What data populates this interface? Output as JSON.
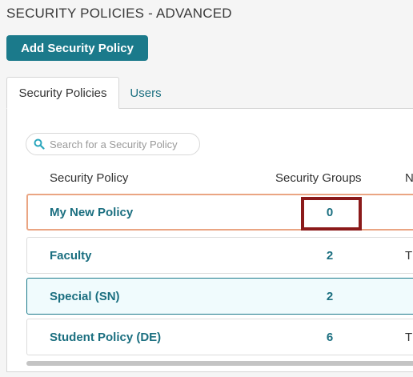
{
  "page": {
    "title": "SECURITY POLICIES - ADVANCED"
  },
  "toolbar": {
    "add_label": "Add Security Policy"
  },
  "tabs": [
    {
      "label": "Security Policies",
      "active": true
    },
    {
      "label": "Users",
      "active": false
    }
  ],
  "search": {
    "placeholder": "Search for a Security Policy",
    "value": ""
  },
  "table": {
    "columns": [
      "Security Policy",
      "Security Groups",
      "N"
    ],
    "rows": [
      {
        "name": "My New Policy",
        "groups": "0",
        "extra": ""
      },
      {
        "name": "Faculty",
        "groups": "2",
        "extra": "T"
      },
      {
        "name": "Special (SN)",
        "groups": "2",
        "extra": ""
      },
      {
        "name": "Student Policy (DE)",
        "groups": "6",
        "extra": "T"
      }
    ]
  },
  "colors": {
    "accent": "#1b7a8b",
    "link": "#1b6f80",
    "new_row_border": "#eaa583",
    "highlight": "#8b1a1a"
  },
  "icons": {
    "search": "search-icon"
  }
}
